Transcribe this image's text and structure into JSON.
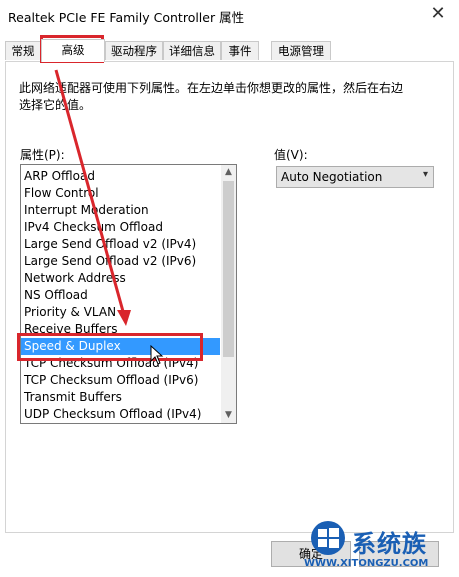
{
  "window": {
    "title": "Realtek PCIe FE Family Controller 属性",
    "close_glyph": "✕"
  },
  "tabs": [
    {
      "label": "常规"
    },
    {
      "label": "高级",
      "active": true
    },
    {
      "label": "驱动程序"
    },
    {
      "label": "详细信息"
    },
    {
      "label": "事件"
    },
    {
      "label": "电源管理"
    }
  ],
  "description": "此网络适配器可使用下列属性。在左边单击你想更改的属性，然后在右边选择它的值。",
  "property_label": "属性(P):",
  "value_label": "值(V):",
  "properties": [
    {
      "name": "ARP Offload"
    },
    {
      "name": "Flow Control"
    },
    {
      "name": "Interrupt Moderation"
    },
    {
      "name": "IPv4 Checksum Offload"
    },
    {
      "name": "Large Send Offload v2 (IPv4)"
    },
    {
      "name": "Large Send Offload v2 (IPv6)"
    },
    {
      "name": "Network Address"
    },
    {
      "name": "NS Offload"
    },
    {
      "name": "Priority & VLAN"
    },
    {
      "name": "Receive Buffers"
    },
    {
      "name": "Speed & Duplex",
      "selected": true
    },
    {
      "name": "TCP Checksum Offload (IPv4)"
    },
    {
      "name": "TCP Checksum Offload (IPv6)"
    },
    {
      "name": "Transmit Buffers"
    },
    {
      "name": "UDP Checksum Offload (IPv4)"
    }
  ],
  "value_select": {
    "value": "Auto Negotiation"
  },
  "buttons": {
    "ok": "确定"
  },
  "watermark": {
    "text": "系统族",
    "url": "WWW.XITONGZU.COM"
  },
  "colors": {
    "selection": "#3399ff",
    "annotation": "#d9262c",
    "brand": "#1a5fb4"
  },
  "icons": {
    "close": "close-icon",
    "scroll_up": "scroll-up-icon",
    "scroll_down": "scroll-down-icon",
    "dropdown": "chevron-down-icon",
    "cursor": "mouse-pointer-icon",
    "logo": "windows-logo-icon"
  }
}
